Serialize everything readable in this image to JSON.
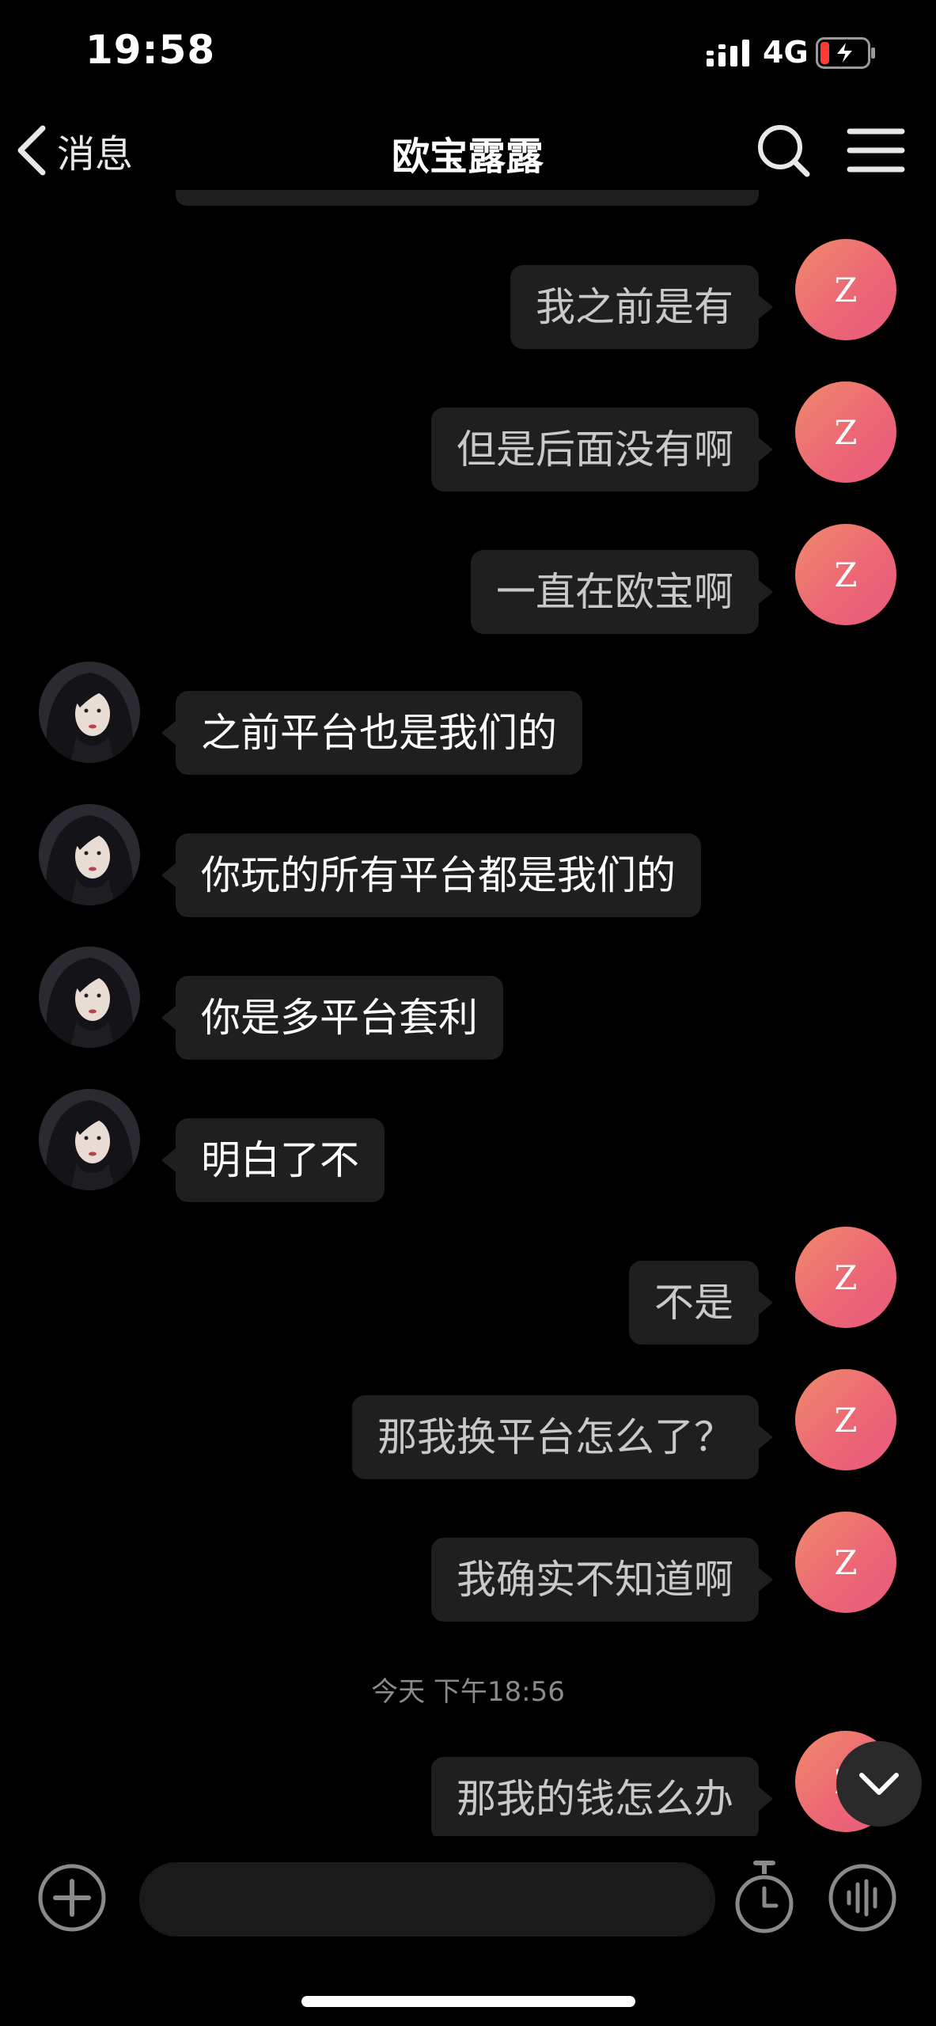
{
  "status_bar": {
    "time": "19:58",
    "network": "4G",
    "battery_state": "low-charging"
  },
  "nav": {
    "back_label": "消息",
    "title": "欧宝露露",
    "icons": [
      "chevron-left-icon",
      "search-icon",
      "menu-icon"
    ]
  },
  "messages": [
    {
      "side": "sent",
      "text": "我之前是有",
      "avatar_letter": "Z"
    },
    {
      "side": "sent",
      "text": "但是后面没有啊",
      "avatar_letter": "Z"
    },
    {
      "side": "sent",
      "text": "一直在欧宝啊",
      "avatar_letter": "Z"
    },
    {
      "side": "received",
      "text": "之前平台也是我们的"
    },
    {
      "side": "received",
      "text": "你玩的所有平台都是我们的"
    },
    {
      "side": "received",
      "text": "你是多平台套利"
    },
    {
      "side": "received",
      "text": "明白了不"
    },
    {
      "side": "sent",
      "text": "不是",
      "avatar_letter": "Z"
    },
    {
      "side": "sent",
      "text": "那我换平台怎么了？",
      "avatar_letter": "Z"
    },
    {
      "side": "sent",
      "text": "我确实不知道啊",
      "avatar_letter": "Z"
    },
    {
      "side": "sent",
      "text": "那我的钱怎么办",
      "avatar_letter": "Z"
    }
  ],
  "timestamp": "今天 下午18:56",
  "input": {
    "placeholder": "",
    "value": ""
  },
  "colors": {
    "background": "#000000",
    "bubble": "#1f1f1f",
    "sent_text": "#c9c9c9",
    "received_text": "#ffffff",
    "avatar_gradient_start": "#f08a6a",
    "avatar_gradient_end": "#e85a7c",
    "battery_low": "#ff3b30"
  }
}
